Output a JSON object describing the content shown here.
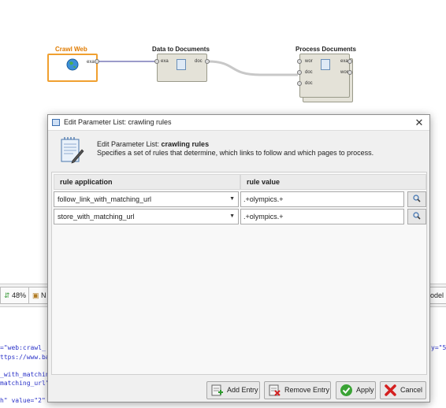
{
  "canvas": {
    "operators": [
      {
        "name": "Crawl Web",
        "ports_out": [
          "exa"
        ]
      },
      {
        "name": "Data to Documents",
        "ports_in": [
          "exa"
        ],
        "ports_out": [
          "doc"
        ]
      },
      {
        "name": "Process Documents",
        "ports_in": [
          "wor",
          "doc",
          "doc"
        ],
        "ports_out": [
          "exa",
          "wor"
        ]
      }
    ]
  },
  "background": {
    "strip_btn1": "48%",
    "strip_btn2": "N",
    "strip_right": "odel",
    "code_lines": [
      "=\"web:crawl_",
      "ttps://www.ba",
      "_with_matchin",
      "matching_url\"",
      "h\" value=\"2\""
    ],
    "code_right": "y=\"5"
  },
  "dialog": {
    "title": "Edit Parameter List: crawling rules",
    "header_prefix": "Edit Parameter List: ",
    "header_bold": "crawling rules",
    "description": "Specifies a set of rules that determine, which links to follow and which pages to process.",
    "columns": [
      "rule application",
      "rule value"
    ],
    "rows": [
      {
        "application": "follow_link_with_matching_url",
        "value": ".+olympics.+"
      },
      {
        "application": "store_with_matching_url",
        "value": ".+olympics.+"
      }
    ],
    "buttons": {
      "add": "Add Entry",
      "remove": "Remove Entry",
      "apply": "Apply",
      "cancel": "Cancel"
    },
    "colors": {
      "apply_green": "#3aa335",
      "cancel_red": "#d42020"
    }
  }
}
